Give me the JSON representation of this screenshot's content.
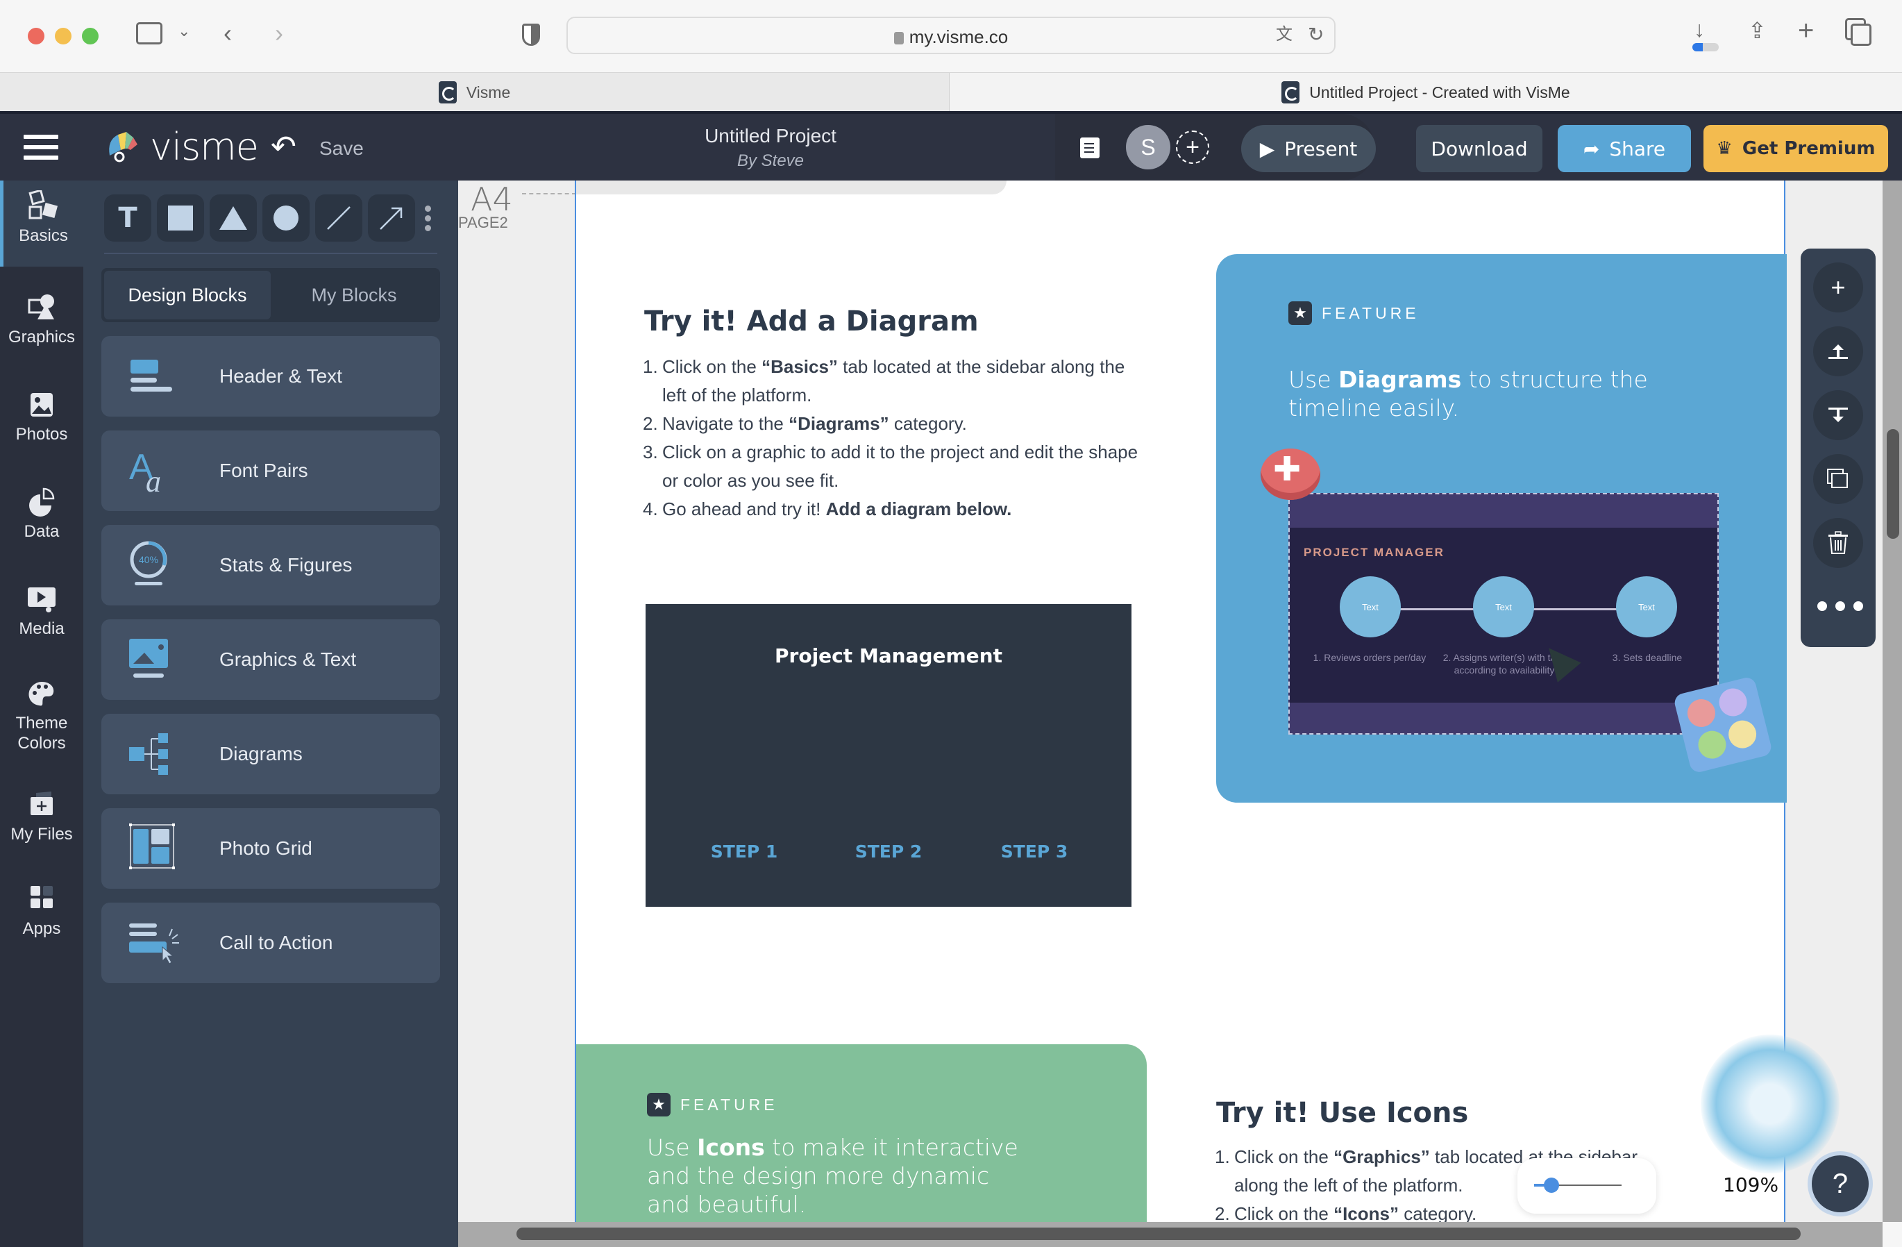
{
  "browser": {
    "url": "my.visme.co",
    "tabs": [
      {
        "title": "Visme",
        "active": false
      },
      {
        "title": "Untitled Project - Created with VisMe",
        "active": true
      }
    ]
  },
  "topbar": {
    "logo_text": "visme",
    "save_label": "Save",
    "project_title": "Untitled Project",
    "project_by": "By Steve",
    "avatar_initial": "S",
    "add_collaborator": "+",
    "present_label": "Present",
    "download_label": "Download",
    "share_label": "Share",
    "premium_label": "Get Premium",
    "colors": {
      "share": "#5aa6d6",
      "premium": "#f3bb4f",
      "bar": "#2d3241"
    }
  },
  "rail": {
    "items": [
      {
        "label": "Basics",
        "icon": "abc-blocks-icon",
        "active": true
      },
      {
        "label": "Graphics",
        "icon": "shapes-icon",
        "active": false
      },
      {
        "label": "Photos",
        "icon": "photo-icon",
        "active": false
      },
      {
        "label": "Data",
        "icon": "pie-chart-icon",
        "active": false
      },
      {
        "label": "Media",
        "icon": "media-play-icon",
        "active": false
      },
      {
        "label": "Theme Colors",
        "icon": "palette-icon",
        "active": false
      },
      {
        "label": "My Files",
        "icon": "folder-plus-icon",
        "active": false
      },
      {
        "label": "Apps",
        "icon": "apps-grid-icon",
        "active": false
      }
    ]
  },
  "panel": {
    "tools": [
      "text-tool",
      "rectangle-tool",
      "triangle-tool",
      "circle-tool",
      "line-tool",
      "arrow-tool"
    ],
    "tabs": [
      {
        "label": "Design Blocks",
        "active": true
      },
      {
        "label": "My Blocks",
        "active": false
      }
    ],
    "blocks": [
      {
        "label": "Header & Text",
        "icon": "header-text-icon"
      },
      {
        "label": "Font Pairs",
        "icon": "font-pairs-icon"
      },
      {
        "label": "Stats & Figures",
        "icon": "stats-ring-icon",
        "icon_text": "40%"
      },
      {
        "label": "Graphics & Text",
        "icon": "graphics-text-icon"
      },
      {
        "label": "Diagrams",
        "icon": "diagram-tree-icon"
      },
      {
        "label": "Photo Grid",
        "icon": "photo-grid-icon"
      },
      {
        "label": "Call to Action",
        "icon": "call-to-action-icon"
      }
    ]
  },
  "canvas": {
    "page_size": "A4",
    "page_label": "PAGE2",
    "section1": {
      "title": "Try it! Add a Diagram",
      "steps": [
        {
          "num": "1.",
          "pre": "Click on the ",
          "bold": "“Basics”",
          "post": " tab located at the sidebar along the left of the platform."
        },
        {
          "num": "2.",
          "pre": "Navigate to the ",
          "bold": "“Diagrams”",
          "post": " category."
        },
        {
          "num": "3.",
          "pre": "Click on a graphic to add it to the project and edit the shape or color as you see fit.",
          "bold": "",
          "post": ""
        },
        {
          "num": "4.",
          "pre": "Go ahead and try it! ",
          "bold": "Add a diagram below.",
          "post": ""
        }
      ]
    },
    "pm_diagram": {
      "title": "Project Management",
      "steps": [
        "STEP 1",
        "STEP 2",
        "STEP 3"
      ]
    },
    "feature_blue": {
      "tag": "FEATURE",
      "text_pre": "Use ",
      "text_bold": "Diagrams",
      "text_post": " to structure the timeline easily.",
      "mock": {
        "title": "PROJECT MANAGER",
        "nodes": [
          {
            "label": "Text",
            "caption": "1. Reviews orders per/day"
          },
          {
            "label": "Text",
            "caption": "2. Assigns writer(s) with task according to availability"
          },
          {
            "label": "Text",
            "caption": "3. Sets deadline"
          }
        ]
      },
      "color": "#5ba7d4"
    },
    "feature_green": {
      "tag": "FEATURE",
      "text_pre": "Use ",
      "text_bold": "Icons",
      "text_post": " to make it interactive and the design more dynamic and beautiful.",
      "color": "#82c09a"
    },
    "section2": {
      "title": "Try it! Use Icons",
      "steps": [
        {
          "num": "1.",
          "pre": "Click on the ",
          "bold": "“Graphics”",
          "post": " tab located at the sidebar along the left of the platform."
        },
        {
          "num": "2.",
          "pre": "Click on the ",
          "bold": "“Icons”",
          "post": " category."
        }
      ]
    }
  },
  "page_tools": [
    "add-page",
    "move-page-up",
    "move-page-down",
    "duplicate-page",
    "delete-page",
    "more-options"
  ],
  "zoom": {
    "value_label": "109%",
    "slider_fraction": 0.2
  },
  "help_label": "?"
}
